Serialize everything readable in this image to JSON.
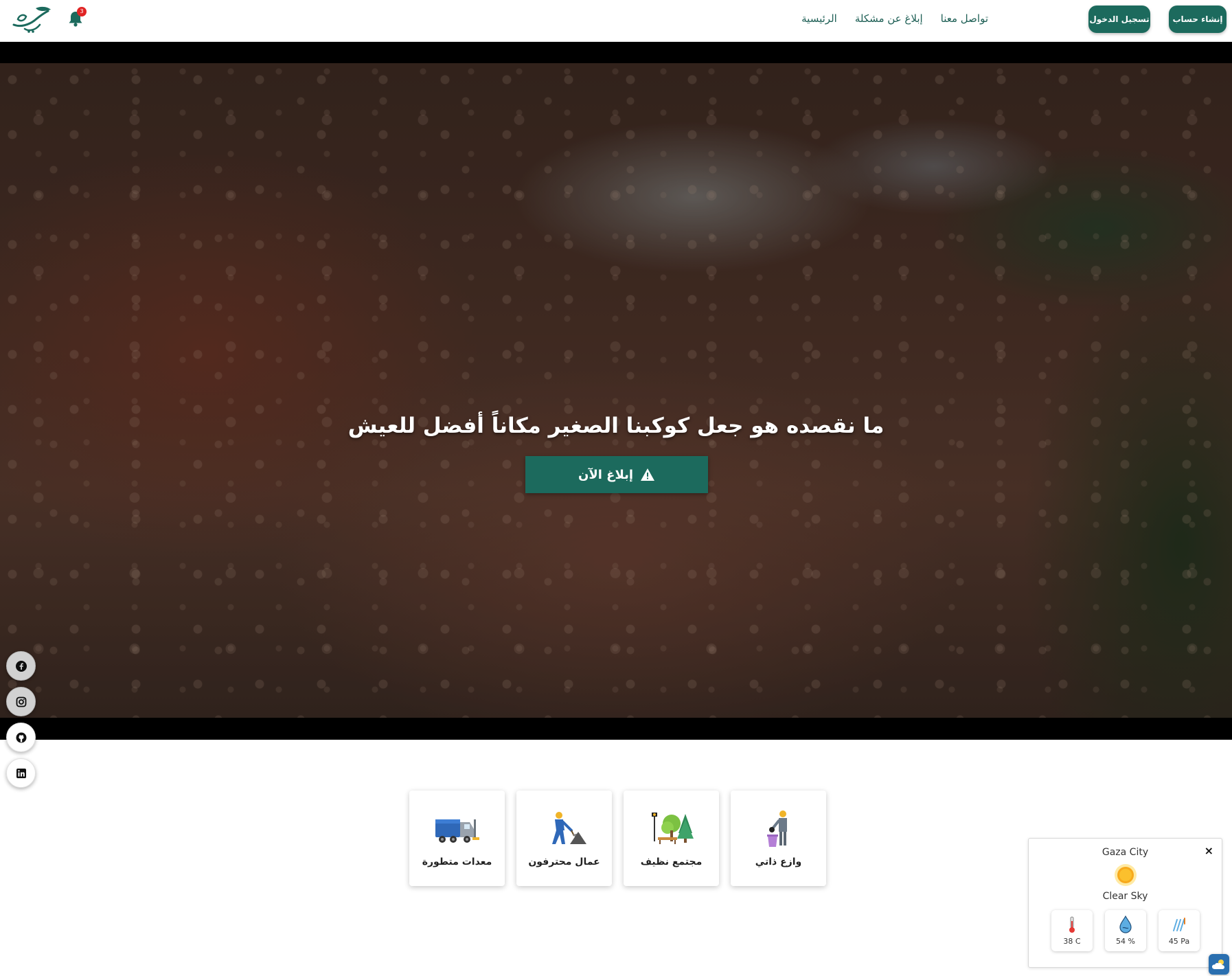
{
  "navbar": {
    "logo_icon": "rasil-logo",
    "notifications": {
      "icon": "bell-icon",
      "count": "3"
    },
    "links": [
      {
        "label": "الرئيسية"
      },
      {
        "label": "إبلاغ عن مشكلة"
      },
      {
        "label": "تواصل معنا"
      }
    ],
    "login_label": "تسجيل الدخول",
    "register_label": "إنشاء حساب"
  },
  "hero": {
    "title": "ما نقصده هو جعل كوكبنا الصغير مكاناً أفضل للعيش",
    "report_button_label": "إبلاغ الآن",
    "report_button_icon": "warning-icon"
  },
  "social": [
    "facebook-icon",
    "instagram-icon",
    "github-icon",
    "linkedin-icon"
  ],
  "features": [
    {
      "label": "وازع ذاتي",
      "icon": "person-bin-icon"
    },
    {
      "label": "مجتمع نظيف",
      "icon": "park-trees-icon"
    },
    {
      "label": "عمال محترفون",
      "icon": "worker-shovel-icon"
    },
    {
      "label": "معدات متطورة",
      "icon": "garbage-truck-icon"
    }
  ],
  "weather": {
    "city": "Gaza City",
    "condition": "Clear Sky",
    "condition_icon": "sun-icon",
    "temperature": "38 C",
    "humidity": "54 %",
    "pressure": "45 Pa",
    "close_label": "×",
    "toggle_icon": "weather-cloud-icon"
  },
  "colors": {
    "brand": "#1c6a5d",
    "badge": "#e02424",
    "nav_text": "#1e5f55"
  }
}
